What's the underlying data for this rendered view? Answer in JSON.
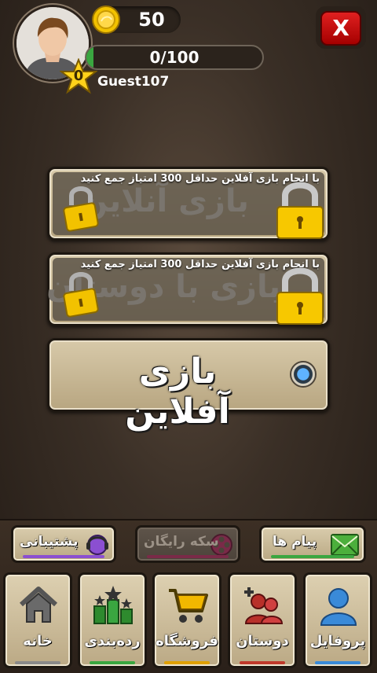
{
  "header": {
    "coins": "50",
    "xp_text": "0/100",
    "xp_progress": 0.0,
    "level": "0",
    "username": "Guest107",
    "close_label": "X"
  },
  "game_buttons": [
    {
      "title": "بازی آنلاین",
      "note": "با انجام بازی آفلاین حداقل 300 امتیاز جمع کنید",
      "locked": true
    },
    {
      "title": "بازی با دوستان",
      "note": "با انجام بازی آفلاین حداقل 300 امتیاز جمع کنید",
      "locked": true
    },
    {
      "title": "بازی آفلاین",
      "locked": false
    }
  ],
  "actions": {
    "support": {
      "label": "پشتیبانی",
      "icon": "headset-icon",
      "color": "#8b4fd1"
    },
    "free_coins": {
      "label": "سکه رایگان",
      "icon": "film-reel-icon",
      "color": "#c0306a",
      "enabled": false
    },
    "messages": {
      "label": "پیام ها",
      "icon": "envelope-icon",
      "color": "#3aa640"
    }
  },
  "tabs": [
    {
      "label": "خانه",
      "icon": "home-icon",
      "color": "#8a8a8a"
    },
    {
      "label": "رده‌بندی",
      "icon": "leaderboard-icon",
      "color": "#3aa640"
    },
    {
      "label": "فروشگاه",
      "icon": "cart-icon",
      "color": "#e0a000"
    },
    {
      "label": "دوستان",
      "icon": "friends-icon",
      "color": "#c0392b"
    },
    {
      "label": "پروفایل",
      "icon": "profile-icon",
      "color": "#3a8ad8"
    }
  ],
  "colors": {
    "accent_green": "#3aa640",
    "close_red": "#d01818",
    "button_beige": "#cbbd9a"
  }
}
